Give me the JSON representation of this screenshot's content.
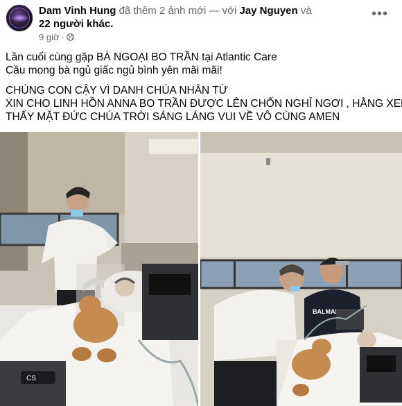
{
  "post": {
    "author": "Dam Vinh Hung",
    "action": " đã thêm 2 ảnh mới — với ",
    "tagged": "Jay Nguyen",
    "and": " và",
    "others": "22 người khác",
    "period": ".",
    "time": "9 giờ",
    "separator": "·",
    "lines": [
      "Lần cuối cùng gặp BÀ NGOẠI BO TRẦN tại Atlantic Care",
      "Cầu mong bà ngủ giấc ngủ bình yên mãi mãi!",
      "CHÚNG CON CẬY VÌ DANH CHÚA NHÂN TỪ",
      "XIN CHO LINH HỒN  ANNA BO TRẦN ĐƯỢC LÊN CHỐN NGHỈ NGƠI , HẰNG XEM",
      "THẤY MẶT ĐỨC CHÚA TRỜI SÁNG LÁNG  VUI VỀ VÔ CÙNG AMEN"
    ],
    "photos": [
      {
        "icon": "hospital-photo-left",
        "bed_label": "CS"
      },
      {
        "icon": "hospital-photo-right",
        "shirt_text": "BALMAIN"
      }
    ]
  },
  "icons": {
    "more": "more-options-icon",
    "privacy": "globe-icon"
  },
  "colors": {
    "text": "#050505",
    "muted": "#65676b"
  }
}
